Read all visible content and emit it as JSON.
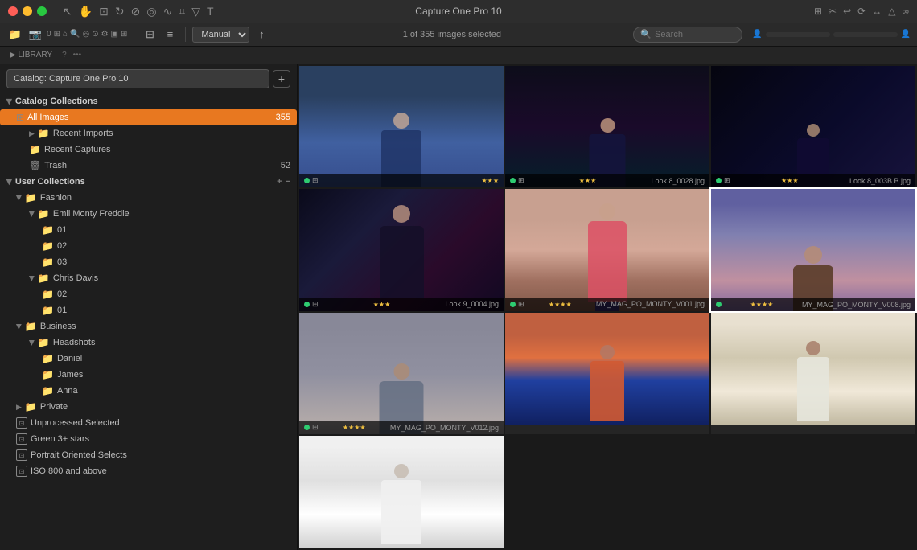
{
  "window": {
    "title": "Capture One Pro 10"
  },
  "toolbar": {
    "image_count": "1 of 355 images selected",
    "search_placeholder": "Search",
    "view_mode": "Manual"
  },
  "sidebar": {
    "title": "LIBRARY",
    "catalog_name": "Catalog: Capture One Pro 10",
    "catalog_collections": {
      "label": "Catalog Collections",
      "items": [
        {
          "label": "All Images",
          "count": "355",
          "active": true,
          "indent": 1
        },
        {
          "label": "Recent Imports",
          "count": "",
          "active": false,
          "indent": 2
        },
        {
          "label": "Recent Captures",
          "count": "",
          "active": false,
          "indent": 2
        },
        {
          "label": "Trash",
          "count": "52",
          "active": false,
          "indent": 2
        }
      ]
    },
    "user_collections": {
      "label": "User Collections",
      "items": [
        {
          "label": "Fashion",
          "indent": 1,
          "type": "group"
        },
        {
          "label": "Emil Monty Freddie",
          "indent": 2,
          "type": "folder"
        },
        {
          "label": "01",
          "indent": 3,
          "type": "folder"
        },
        {
          "label": "02",
          "indent": 3,
          "type": "folder"
        },
        {
          "label": "03",
          "indent": 3,
          "type": "folder"
        },
        {
          "label": "Chris Davis",
          "indent": 2,
          "type": "folder"
        },
        {
          "label": "02",
          "indent": 3,
          "type": "folder"
        },
        {
          "label": "01",
          "indent": 3,
          "type": "folder"
        },
        {
          "label": "Business",
          "indent": 1,
          "type": "group"
        },
        {
          "label": "Headshots",
          "indent": 2,
          "type": "folder"
        },
        {
          "label": "Daniel",
          "indent": 3,
          "type": "folder"
        },
        {
          "label": "James",
          "indent": 3,
          "type": "folder"
        },
        {
          "label": "Anna",
          "indent": 3,
          "type": "folder"
        },
        {
          "label": "Private",
          "indent": 1,
          "type": "group"
        }
      ]
    },
    "smart_albums": [
      {
        "label": "Unprocessed Selected"
      },
      {
        "label": "Green 3+ stars"
      },
      {
        "label": "Portrait Oriented Selects"
      },
      {
        "label": "ISO 800 and above"
      }
    ]
  },
  "images": [
    {
      "filename": "Look 8_0028.jpg",
      "stars": 3,
      "has_dot": true,
      "row": 1,
      "style": "photo-1"
    },
    {
      "filename": "Look 8_003B B.jpg",
      "stars": 3,
      "has_dot": true,
      "row": 1,
      "style": "photo-2"
    },
    {
      "filename": "Look 9_0004.jpg",
      "stars": 3,
      "has_dot": true,
      "row": 1,
      "style": "photo-3"
    },
    {
      "filename": "MY_MAG_PO_MONTY_V001.jpg",
      "stars": 4,
      "has_dot": true,
      "row": 2,
      "style": "photo-4"
    },
    {
      "filename": "MY_MAG_PO_MONTY_V008.jpg",
      "stars": 4,
      "has_dot": true,
      "row": 2,
      "style": "photo-5",
      "selected": true
    },
    {
      "filename": "MY_MAG_PO_MONTY_V012.jpg",
      "stars": 4,
      "has_dot": true,
      "row": 2,
      "style": "photo-6"
    },
    {
      "filename": "",
      "stars": 0,
      "has_dot": false,
      "row": 3,
      "style": "photo-7"
    },
    {
      "filename": "",
      "stars": 0,
      "has_dot": false,
      "row": 3,
      "style": "photo-8"
    },
    {
      "filename": "",
      "stars": 0,
      "has_dot": false,
      "row": 3,
      "style": "photo-9"
    }
  ]
}
